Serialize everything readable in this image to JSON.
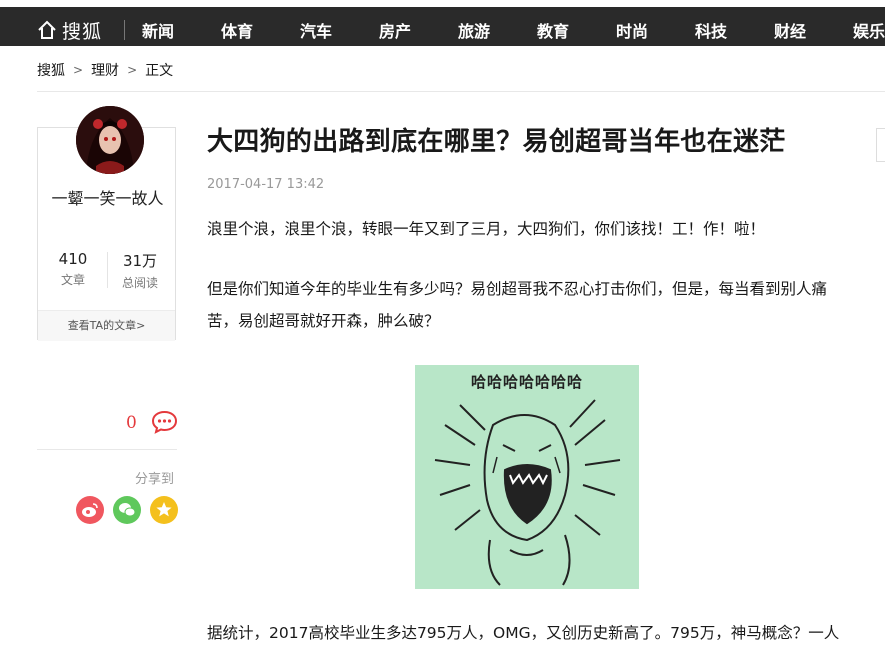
{
  "nav": {
    "logo_text": "搜狐",
    "items": [
      "新闻",
      "体育",
      "汽车",
      "房产",
      "旅游",
      "教育",
      "时尚",
      "科技",
      "财经",
      "娱乐"
    ]
  },
  "breadcrumb": [
    "搜狐",
    "理财",
    "正文"
  ],
  "author": {
    "name": "一颦一笑一故人",
    "articles_count": "410",
    "articles_label": "文章",
    "reads_count": "31万",
    "reads_label": "总阅读",
    "view_articles": "查看TA的文章>"
  },
  "actions": {
    "comment_count": "0",
    "share_label": "分享到"
  },
  "article": {
    "title": "大四狗的出路到底在哪里？易创超哥当年也在迷茫",
    "date": "2017-04-17 13:42",
    "paragraphs": [
      "浪里个浪，浪里个浪，转眼一年又到了三月，大四狗们，你们该找！工！作！啦！",
      "但是你们知道今年的毕业生有多少吗？易创超哥我不忍心打击你们，但是，每当看到别人痛苦，易创超哥就好开森，肿么破？",
      "据统计，2017高校毕业生多达795万人，OMG，又创历史新高了。795万，神马概念？一人"
    ],
    "meme_caption": "哈哈哈哈哈哈哈"
  },
  "colors": {
    "nav_bg": "#2a2a2a",
    "accent_red": "#e4393c",
    "weibo": "#f0575f",
    "wechat": "#5fc85c",
    "star": "#f4c01d"
  }
}
